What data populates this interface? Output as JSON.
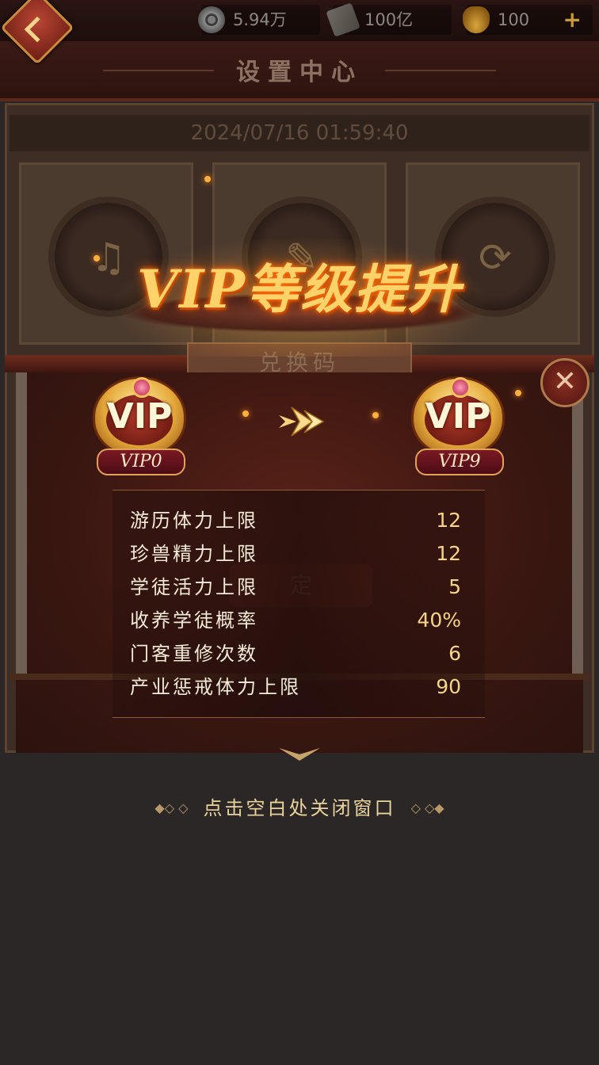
{
  "topbar": {
    "resources": [
      {
        "icon": "copper-coin-icon",
        "value": "5.94万"
      },
      {
        "icon": "book-icon",
        "value": "100亿"
      },
      {
        "icon": "gold-ingot-icon",
        "value": "100"
      }
    ],
    "add_label": "+"
  },
  "page": {
    "title": "设置中心",
    "datetime": "2024/07/16 01:59:40",
    "redeem_code_label": "兑换码",
    "confirm_label_partial": "定"
  },
  "popup": {
    "title": "VIP等级提升",
    "from_badge": {
      "text": "VIP",
      "level": "VIP0"
    },
    "to_badge": {
      "text": "VIP",
      "level": "VIP9"
    },
    "stats": [
      {
        "label": "游历体力上限",
        "value": "12"
      },
      {
        "label": "珍兽精力上限",
        "value": "12"
      },
      {
        "label": "学徒活力上限",
        "value": "5"
      },
      {
        "label": "收养学徒概率",
        "value": "40%"
      },
      {
        "label": "门客重修次数",
        "value": "6"
      },
      {
        "label": "产业惩戒体力上限",
        "value": "90"
      }
    ],
    "close_hint": "点击空白处关闭窗口",
    "close_glyph": "✕",
    "hint_deco_left": "◆◇ ◇",
    "hint_deco_right": "◇ ◇◆"
  },
  "colors": {
    "title_glow": "#ffd36a",
    "value_gold": "#f5d58a",
    "label_text": "#f4ead8"
  }
}
